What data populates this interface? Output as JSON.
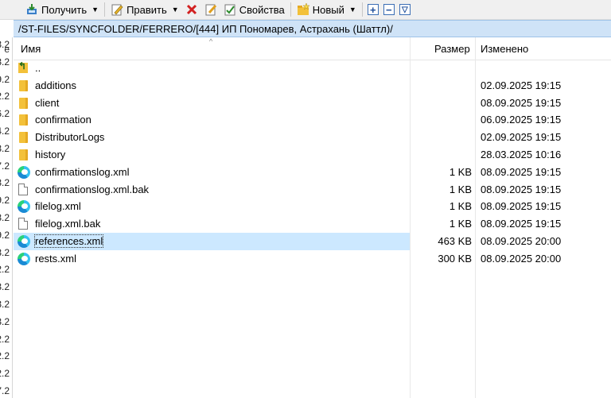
{
  "toolbar": {
    "get_label": "Получить",
    "edit_label": "Править",
    "properties_label": "Свойства",
    "new_label": "Новый"
  },
  "path": "/ST-FILES/SYNCFOLDER/FERRERO/[444] ИП Пономарев, Астрахань (Шаттл)/",
  "gutter": [
    "е",
    "3.2",
    "3.2",
    "9.2",
    "2.2",
    "6.2",
    "4.2",
    "3.2",
    "7.2",
    "3.2",
    "9.2",
    "3.2",
    "9.2",
    "3.2",
    "2.2",
    "3.2",
    "3.2",
    "3.2",
    "2.2",
    "2.2",
    "2.2",
    "7.2",
    "2.2"
  ],
  "columns": {
    "name": "Имя",
    "size": "Размер",
    "modified": "Изменено"
  },
  "files": [
    {
      "name": "..",
      "size": "",
      "date": "",
      "icon": "up-folder-icon"
    },
    {
      "name": "additions",
      "size": "",
      "date": "02.09.2025 19:15",
      "icon": "folder-icon"
    },
    {
      "name": "client",
      "size": "",
      "date": "08.09.2025 19:15",
      "icon": "folder-icon"
    },
    {
      "name": "confirmation",
      "size": "",
      "date": "06.09.2025 19:15",
      "icon": "folder-icon"
    },
    {
      "name": "DistributorLogs",
      "size": "",
      "date": "02.09.2025 19:15",
      "icon": "folder-icon"
    },
    {
      "name": "history",
      "size": "",
      "date": "28.03.2025 10:16",
      "icon": "folder-icon"
    },
    {
      "name": "confirmationslog.xml",
      "size": "1 KB",
      "date": "08.09.2025 19:15",
      "icon": "edge-xml-icon"
    },
    {
      "name": "confirmationslog.xml.bak",
      "size": "1 KB",
      "date": "08.09.2025 19:15",
      "icon": "file-icon"
    },
    {
      "name": "filelog.xml",
      "size": "1 KB",
      "date": "08.09.2025 19:15",
      "icon": "edge-xml-icon"
    },
    {
      "name": "filelog.xml.bak",
      "size": "1 KB",
      "date": "08.09.2025 19:15",
      "icon": "file-icon"
    },
    {
      "name": "references.xml",
      "size": "463 KB",
      "date": "08.09.2025 20:00",
      "icon": "edge-xml-icon",
      "selected": true
    },
    {
      "name": "rests.xml",
      "size": "300 KB",
      "date": "08.09.2025 20:00",
      "icon": "edge-xml-icon"
    }
  ]
}
